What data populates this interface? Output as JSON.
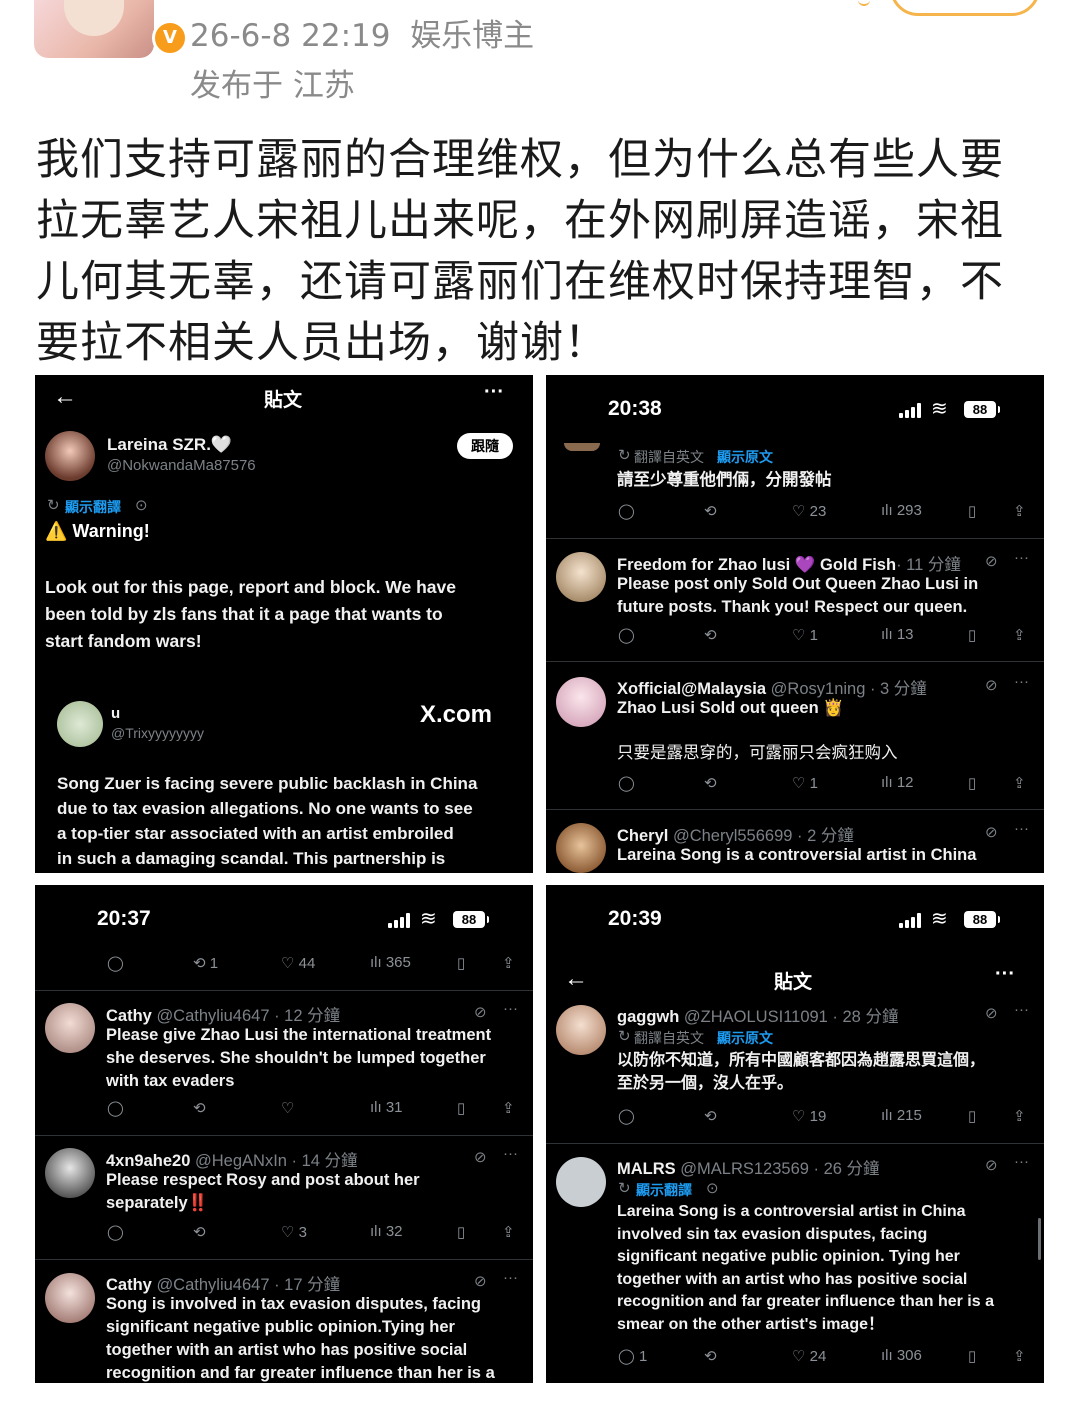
{
  "header": {
    "timestamp": "26-6-8 22:19",
    "role": "娱乐博主",
    "location": "发布于 江苏",
    "verified_badge": "V"
  },
  "post": {
    "lines": [
      "我们支持可露丽的合理维权，但为什么总有些人要",
      "拉无辜艺人宋祖儿出来呢，在外网刷屏造谣，宋祖",
      "儿何其无辜，还请可露丽们在维权时保持理智，不",
      "要拉不相关人员出场，谢谢！"
    ]
  },
  "shot1": {
    "title": "貼文",
    "back_icon": "←",
    "more_icon": "···",
    "author_name": "Lareina SZR.🤍",
    "author_handle": "@NokwandaMa87576",
    "follow_label": "跟隨",
    "translate_label": "顯示翻譯",
    "warning": "⚠️ Warning!",
    "body_lines": [
      "Look out for this page, report and block. We have",
      "been told by zls fans that it a page that wants to",
      "start fandom wars!"
    ],
    "quote_name": "u",
    "quote_handle": "@Trixyyyyyyyy",
    "quote_brand": "X.com",
    "quote_lines": [
      "Song Zuer is facing severe public backlash in China",
      "due to tax evasion allegations. No one wants to see",
      "a top-tier star associated with an artist embroiled",
      "in such a damaging scandal. This partnership is"
    ]
  },
  "shot2": {
    "time": "20:38",
    "battery": "88",
    "top_translate": "翻譯自英文",
    "top_show_original": "顯示原文",
    "top_text": "請至少尊重他們倆，分開發帖",
    "top_likes": "23",
    "top_views": "293",
    "r1_name": "Freedom for Zhao lusi 💜 Gold Fish",
    "r1_time": "· 11 分鐘",
    "r1_lines": [
      "Please post only Sold Out Queen Zhao Lusi in",
      "future posts. Thank you! Respect our queen."
    ],
    "r1_likes": "1",
    "r1_views": "13",
    "r2_name": "Xofficial@Malaysia",
    "r2_handle": "@Rosy1ning · 3 分鐘",
    "r2_line": "Zhao Lusi Sold out queen 👸",
    "r2_cn": "只要是露思穿的，可露丽只会疯狂购入",
    "r2_likes": "1",
    "r2_views": "12",
    "r3_name": "Cheryl",
    "r3_handle": "@Cheryl556699 · 2 分鐘",
    "r3_line": "Lareina Song is a controversial artist in China"
  },
  "shot3": {
    "time": "20:37",
    "battery": "88",
    "top_retweets": "1",
    "top_likes": "44",
    "top_views": "365",
    "r1_name": "Cathy",
    "r1_handle": "@Cathyliu4647 · 12 分鐘",
    "r1_lines": [
      "Please give Zhao Lusi the international treatment",
      "she deserves. She shouldn't be lumped together",
      "with tax evaders"
    ],
    "r1_views": "31",
    "r2_name": "4xn9ahe20",
    "r2_handle": "@HegANxIn · 14 分鐘",
    "r2_lines": [
      "Please respect Rosy and post about her",
      "separately‼️"
    ],
    "r2_likes": "3",
    "r2_views": "32",
    "r3_name": "Cathy",
    "r3_handle": "@Cathyliu4647 · 17 分鐘",
    "r3_lines": [
      "Song is involved in tax evasion disputes, facing",
      "significant negative public opinion.Tying her",
      "together with an artist who has positive social",
      "recognition and far greater influence than her is a"
    ]
  },
  "shot4": {
    "time": "20:39",
    "battery": "88",
    "title": "貼文",
    "r1_name": "gaggwh",
    "r1_handle": "@ZHAOLUSI11091 · 28 分鐘",
    "r1_translate": "翻譯自英文",
    "r1_show_original": "顯示原文",
    "r1_lines": [
      "以防你不知道，所有中國顧客都因為趙露思買這個，",
      "至於另一個，沒人在乎。"
    ],
    "r1_likes": "19",
    "r1_views": "215",
    "r2_name": "MALRS",
    "r2_handle": "@MALRS123569 · 26 分鐘",
    "r2_translate": "顯示翻譯",
    "r2_lines": [
      "Lareina Song is a controversial artist in China",
      "involved sin tax evasion disputes, facing",
      "significant negative public opinion. Tying her",
      "together with an artist who has positive social",
      "recognition and far greater influence than her is a",
      "smear on the other artist's image！"
    ],
    "r2_replies": "1",
    "r2_likes": "24",
    "r2_views": "306"
  }
}
